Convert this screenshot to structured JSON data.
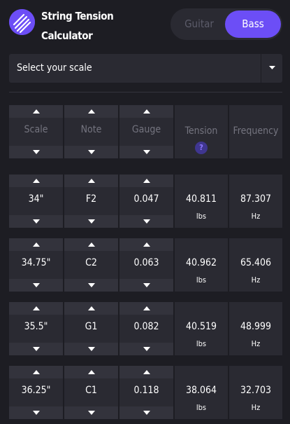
{
  "header": {
    "title": "String Tension Calculator",
    "logo_icon": "logo-icon",
    "accent": "#6c4ef6"
  },
  "toggle": {
    "options": [
      "Guitar",
      "Bass"
    ],
    "selected": "Bass"
  },
  "scale_select": {
    "label": "Select your scale"
  },
  "columns": [
    "Scale",
    "Note",
    "Gauge",
    "Tension",
    "Frequency"
  ],
  "help_label": "?",
  "rows": [
    {
      "scale": "34\"",
      "note": "F2",
      "gauge": "0.047",
      "tension": "40.811",
      "tension_unit": "lbs",
      "frequency": "87.307",
      "frequency_unit": "Hz"
    },
    {
      "scale": "34.75\"",
      "note": "C2",
      "gauge": "0.063",
      "tension": "40.962",
      "tension_unit": "lbs",
      "frequency": "65.406",
      "frequency_unit": "Hz"
    },
    {
      "scale": "35.5\"",
      "note": "G1",
      "gauge": "0.082",
      "tension": "40.519",
      "tension_unit": "lbs",
      "frequency": "48.999",
      "frequency_unit": "Hz"
    },
    {
      "scale": "36.25\"",
      "note": "C1",
      "gauge": "0.118",
      "tension": "38.064",
      "tension_unit": "lbs",
      "frequency": "32.703",
      "frequency_unit": "Hz"
    }
  ]
}
